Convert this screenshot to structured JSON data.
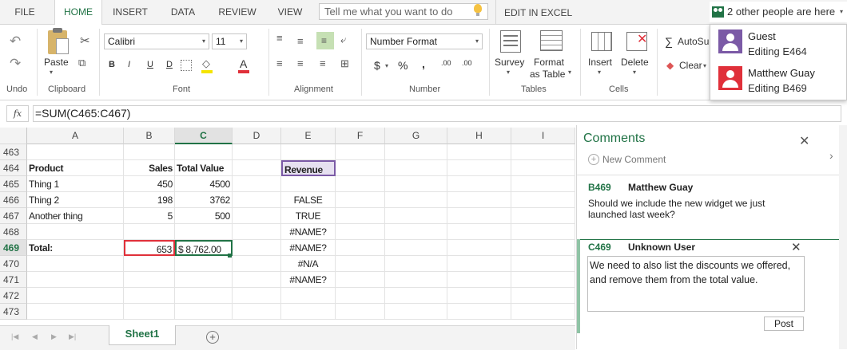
{
  "tabs": [
    "FILE",
    "HOME",
    "INSERT",
    "DATA",
    "REVIEW",
    "VIEW"
  ],
  "tell_me": "Tell me what you want to do",
  "edit_in_excel": "EDIT IN EXCEL",
  "presence": {
    "summary": "2 other people are here",
    "people": [
      {
        "name": "Guest",
        "status": "Editing E464",
        "color": "#7b5aa6"
      },
      {
        "name": "Matthew Guay",
        "status": "Editing B469",
        "color": "#e0303a"
      }
    ]
  },
  "ribbon": {
    "undo_label": "Undo",
    "clipboard": {
      "paste": "Paste",
      "group": "Clipboard"
    },
    "font": {
      "name": "Calibri",
      "size": "11",
      "bold": "B",
      "italic": "I",
      "underline": "U",
      "dunder": "D",
      "group": "Font"
    },
    "alignment": {
      "group": "Alignment"
    },
    "number": {
      "format": "Number Format",
      "currency": "$",
      "percent": "%",
      "comma": ",",
      "inc": ".00",
      "group": "Number"
    },
    "tables": {
      "survey": "Survey",
      "format_table_1": "Format",
      "format_table_2": "as Table",
      "group": "Tables"
    },
    "cells": {
      "insert": "Insert",
      "delete": "Delete",
      "group": "Cells"
    },
    "editing": {
      "autosum": "AutoSu",
      "clear": "Clear"
    }
  },
  "formula": {
    "fx": "fx",
    "value": "=SUM(C465:C467)"
  },
  "columns": [
    "A",
    "B",
    "C",
    "D",
    "E",
    "F",
    "G",
    "H",
    "I"
  ],
  "selected_column": "C",
  "rows": [
    {
      "n": "463",
      "A": "",
      "B": "",
      "C": "",
      "E": ""
    },
    {
      "n": "464",
      "A": "Product",
      "B": "Sales",
      "C": "Total Value",
      "E": "Revenue"
    },
    {
      "n": "465",
      "A": "Thing 1",
      "B": "450",
      "C": "4500",
      "E": ""
    },
    {
      "n": "466",
      "A": "Thing 2",
      "B": "198",
      "C": "3762",
      "E": "FALSE"
    },
    {
      "n": "467",
      "A": "Another thing",
      "B": "5",
      "C": "500",
      "E": "TRUE"
    },
    {
      "n": "468",
      "A": "",
      "B": "",
      "C": "",
      "E": "#NAME?"
    },
    {
      "n": "469",
      "A": "Total:",
      "B": "653",
      "C": "$ 8,762.00",
      "E": "#NAME?"
    },
    {
      "n": "470",
      "A": "",
      "B": "",
      "C": "",
      "E": "#N/A"
    },
    {
      "n": "471",
      "A": "",
      "B": "",
      "C": "",
      "E": "#NAME?"
    },
    {
      "n": "472",
      "A": "",
      "B": "",
      "C": "",
      "E": ""
    },
    {
      "n": "473",
      "A": "",
      "B": "",
      "C": "",
      "E": ""
    }
  ],
  "selected_row": "469",
  "sheet": {
    "name": "Sheet1",
    "add": "+"
  },
  "comments": {
    "title": "Comments",
    "new_comment": "New Comment",
    "thread1": {
      "ref": "B469",
      "author": "Matthew Guay",
      "text": "Should we include the new widget we just launched last week?"
    },
    "thread2": {
      "ref": "C469",
      "author": "Unknown User",
      "text": "We need to also list the discounts we offered, and remove them from the total value."
    },
    "post": "Post"
  }
}
